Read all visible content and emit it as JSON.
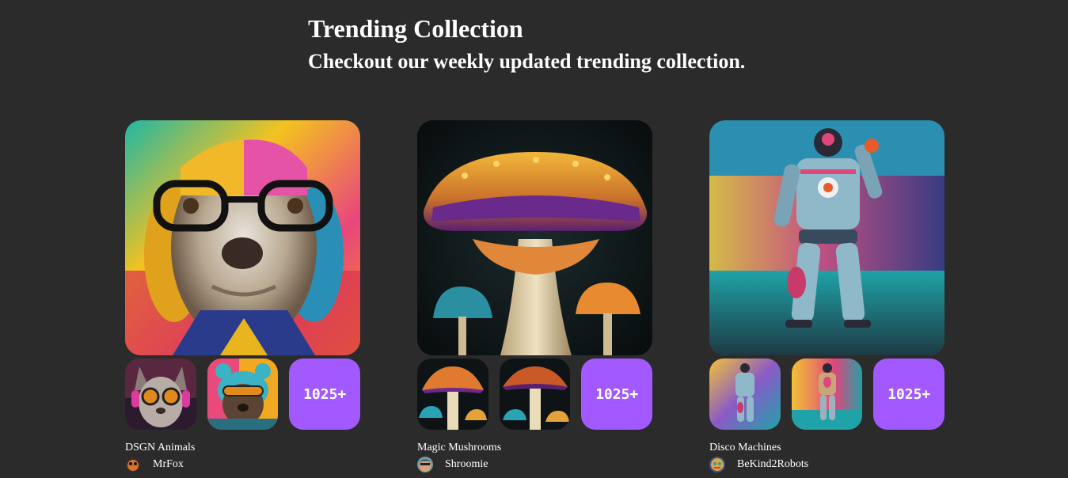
{
  "header": {
    "title": "Trending Collection",
    "subtitle": "Checkout our weekly updated trending collection."
  },
  "collections": [
    {
      "name": "DSGN Animals",
      "artist": "MrFox",
      "more_label": "1025+",
      "hero_image": "dog-with-glasses-image",
      "thumb_images": [
        "cat-with-goggles-image",
        "bear-with-glasses-image"
      ]
    },
    {
      "name": "Magic Mushrooms",
      "artist": "Shroomie",
      "more_label": "1025+",
      "hero_image": "glowing-mushroom-image",
      "thumb_images": [
        "mushroom-thumbnail-image",
        "mushroom-thumbnail-image"
      ]
    },
    {
      "name": "Disco Machines",
      "artist": "BeKind2Robots",
      "more_label": "1025+",
      "hero_image": "robot-astronaut-image",
      "thumb_images": [
        "robot-thumbnail-image",
        "robot-thumbnail-image"
      ]
    }
  ],
  "colors": {
    "background": "#2b2b2b",
    "accent": "#a259ff",
    "text": "#ffffff"
  }
}
